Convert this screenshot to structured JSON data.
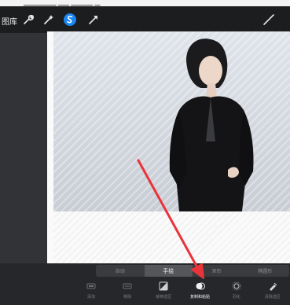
{
  "top_strip": {
    "partial_text": "▁▁▁▁▁▁ ▁▁ ▁▁▁▁ ▁"
  },
  "toolbar": {
    "gallery_label": "图库",
    "icons": [
      "wrench-icon",
      "magic-wand-icon",
      "selection-s-icon",
      "transform-arrow-icon",
      "brush-icon"
    ],
    "accent": "#1a86f5"
  },
  "selection_modes": [
    {
      "label": "自动",
      "active": false
    },
    {
      "label": "手绘",
      "active": true
    },
    {
      "label": "矩形",
      "active": false
    },
    {
      "label": "椭圆形",
      "active": false
    }
  ],
  "selection_tools": [
    {
      "label": "添加",
      "icon": "add-icon"
    },
    {
      "label": "移除",
      "icon": "remove-icon"
    },
    {
      "label": "颠倒选区",
      "icon": "invert-icon"
    },
    {
      "label": "复制和粘贴",
      "icon": "copy-paste-icon",
      "active": true
    },
    {
      "label": "羽化",
      "icon": "feather-icon"
    },
    {
      "label": "清除选区",
      "icon": "clear-icon"
    }
  ],
  "annotation": {
    "color": "#e8343a"
  }
}
